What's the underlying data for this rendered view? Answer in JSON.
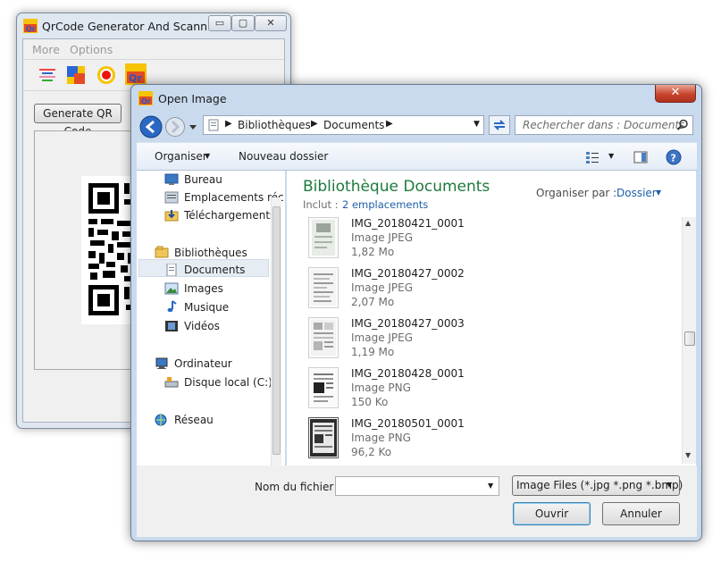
{
  "qr_window": {
    "title": "QrCode Generator And Scann...",
    "menu": [
      "More",
      "Options"
    ],
    "generate_button": "Generate QR Code",
    "caption_minimize": "▭",
    "caption_maximize": "▢",
    "caption_close": "✕"
  },
  "dialog": {
    "title": "Open Image",
    "close_glyph": "✕",
    "breadcrumb": [
      "Bibliothèques",
      "Documents"
    ],
    "search_placeholder": "Rechercher dans : Documents",
    "toolbar": {
      "organize": "Organiser",
      "new_folder": "Nouveau dossier"
    },
    "nav": {
      "favorites": [
        "Bureau",
        "Emplacements réc",
        "Téléchargements"
      ],
      "libraries_header": "Bibliothèques",
      "libraries": [
        "Documents",
        "Images",
        "Musique",
        "Vidéos"
      ],
      "computer_header": "Ordinateur",
      "computer": [
        "Disque local (C:)"
      ],
      "network": "Réseau"
    },
    "library": {
      "title": "Bibliothèque Documents",
      "includes_label": "Inclut :",
      "includes_link": "2 emplacements",
      "arrange_label": "Organiser par :",
      "arrange_value": "Dossier"
    },
    "files": [
      {
        "name": "IMG_20180421_0001",
        "type": "Image JPEG",
        "size": "1,82 Mo"
      },
      {
        "name": "IMG_20180427_0002",
        "type": "Image JPEG",
        "size": "2,07 Mo"
      },
      {
        "name": "IMG_20180427_0003",
        "type": "Image JPEG",
        "size": "1,19 Mo"
      },
      {
        "name": "IMG_20180428_0001",
        "type": "Image PNG",
        "size": "150 Ko"
      },
      {
        "name": "IMG_20180501_0001",
        "type": "Image PNG",
        "size": "96,2 Ko"
      }
    ],
    "filename_label": "Nom du fichier :",
    "filename_value": "",
    "filter": "Image Files (*.jpg *.png *.bmp)",
    "open_button": "Ouvrir",
    "cancel_button": "Annuler"
  },
  "colors": {
    "library_title": "#1e7a3c",
    "link": "#1f5fa8",
    "selection": "#dbe8f7"
  }
}
